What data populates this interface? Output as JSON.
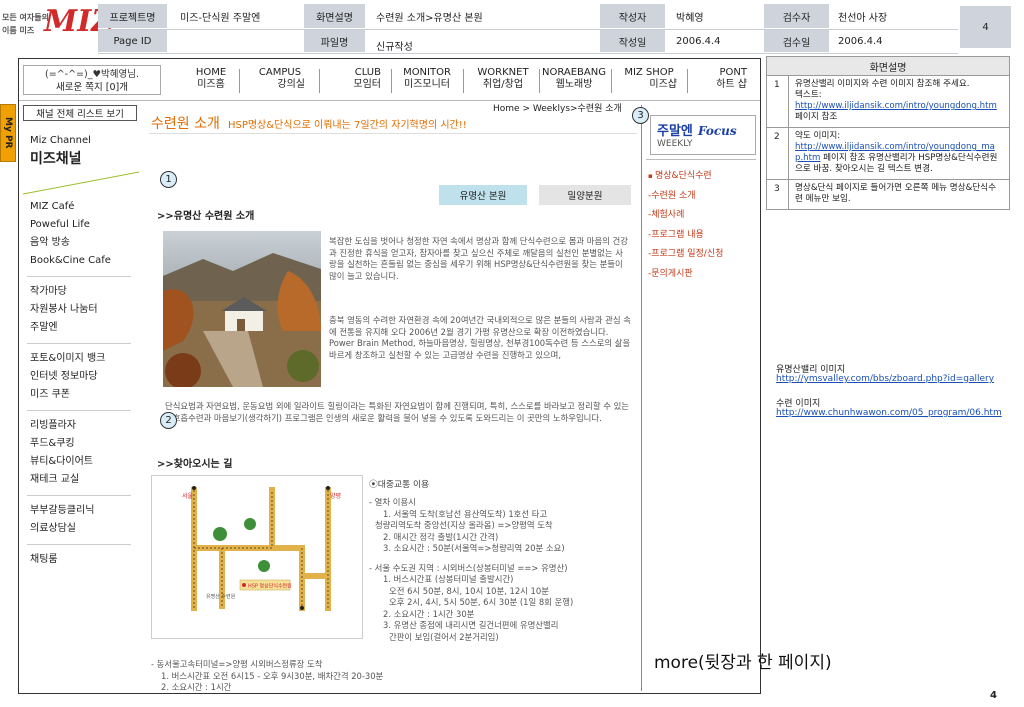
{
  "header": {
    "logo_line1": "모든 여자들의",
    "logo_line2": "이름 미즈",
    "logo_big": "MIZ",
    "project_label": "프로젝트명",
    "project_value": "미즈-단식원 주말엔",
    "page_id_label": "Page ID",
    "screen_label": "화면설명",
    "screen_value": "수련원 소개>유명산 본원",
    "file_label": "파일명",
    "file_value": "신규작성",
    "author_label": "작성자",
    "author_value": "박혜영",
    "date_label": "작성일",
    "date_value": "2006.4.4",
    "reviewer_label": "검수자",
    "reviewer_value": "천선아 사장",
    "review_date_label": "검수일",
    "review_date_value": "2006.4.4",
    "page_number": "4"
  },
  "login": {
    "line1": "(=^-^=)_♥박혜영님.",
    "line2": "새로운 쪽지 [0]개"
  },
  "nav": [
    {
      "en": "HOME",
      "ko": "미즈홈"
    },
    {
      "en": "CAMPUS",
      "ko": "강의실"
    },
    {
      "en": "CLUB",
      "ko": "모임터"
    },
    {
      "en": "MONITOR",
      "ko": "미즈모니터"
    },
    {
      "en": "WORKNET",
      "ko": "취업/창업"
    },
    {
      "en": "NORAEBANG",
      "ko": "웹노래방"
    },
    {
      "en": "MIZ SHOP",
      "ko": "미즈샵"
    },
    {
      "en": "PONT",
      "ko": "하트 샵"
    }
  ],
  "mypr": "My PR",
  "sidebar": {
    "channel_list_button": "채널 전체 리스트 보기",
    "channel_en": "Miz Channel",
    "channel_ko": "미즈채널",
    "groups": [
      [
        "MIZ Café",
        "Poweful Life",
        "음악 방송",
        "Book&Cine Cafe"
      ],
      [
        "작가마당",
        "자원봉사 나눔터",
        "주말엔"
      ],
      [
        "포토&이미지 뱅크",
        "인터넷 정보마당",
        "미즈 쿠폰"
      ],
      [
        "리빙플라자",
        "푸드&쿠킹",
        "뷰티&다이어트",
        "재테크 교실"
      ],
      [
        "부부갈등클리닉",
        "의료상담실"
      ],
      [
        "채팅룸"
      ]
    ]
  },
  "main": {
    "breadcrumb": "Home > Weeklys>수련원 소개",
    "title": "수련원 소개",
    "title_sub": "HSP명상&단식으로 이뤄내는 7일간의 자기혁명의 시간!!",
    "tab_active": "유명산 본원",
    "tab_inactive": "밀양분원",
    "section1_title": ">>유명산 수련원 소개",
    "intro_p1": "복잡한 도심을 벗어나 청정한 자연 속에서 명상과 함께 단식수련으로 몸과 마음의 건강과 진정한 휴식을 얻고자, 참자아를 찾고 싶으신 주체로 깨달음의 실천인 분별없는 사랑을 실천하는 흔들림 없는 중심을 세우기 위해 HSP명상&단식수련원을 찾는 분들이 많이 늘고 있습니다.",
    "intro_p2": "충북 영동의 수려한 자연환경 속에 20여년간 국내외적으로 많은 분들의 사랑과 관심 속에 전통을 유지해 오다 2006년 2월 경기 가평 유명산으로 확장 이전하였습니다. Power Brain Method, 하늘마음명상, 힐링명상, 천부경100독수련 등 스스로의 삶을 바르게 창조하고 실천할 수 있는 고급명상 수련을 진행하고 있으며,",
    "intro_p3": "단식요법과 자연요법, 운동요법 외에 일라이트 힐링이라는 특화된 자연요법이 함께 진행되며, 특히, 스스로를 바라보고 정리할 수 있는 뇌호흡수련과 마음보기(생각하기) 프로그램은 인생의 새로운 활력을 불어 넣을 수 있도록 도와드리는 이 곳만의 노하우입니다.",
    "section2_title": ">>찾아오시는 길",
    "transport_title": "⦿대중교통 이용",
    "transport_lines": [
      "- 열차 이용시",
      "1. 서울역 도착(호남선 용산역도착) 1호선 타고",
      "청량리역도착 중앙선(지상 올라옴) =>양평역 도착",
      "2. 매시간 정각 출발(1시간 간격)",
      "3. 소요시간 : 50분(서울역=>청량리역 20분 소요)",
      "- 서울 수도권 지역 : 시외버스(상봉터미널 ==> 유명산)",
      "1. 버스시간표 (상봉터미널 출발시간)",
      "오전 6시 50분, 8시, 10시 10분, 12시 10분",
      "오후 2시, 4시, 5시 50분, 6시 30분 (1일 8회 운행)",
      "2. 소요시간 : 1시간 30분",
      "3. 유명산 종점에 내리시면 길건너편에 유명산밸리",
      "간판이 보임(걸어서 2분거리임)"
    ],
    "bottom_lines": [
      "- 동서울고속터미널=>양평 시외버스정류장 도착",
      "1. 버스시간표 오전 6시15 - 오후 9시30분, 배차간격 20-30분",
      "2. 소요시간 : 1시간"
    ],
    "map_labels": {
      "seoul": "서울",
      "yangpyeong": "양평",
      "center": "HSP 명상단식수련원",
      "station": "유명산 수련원"
    }
  },
  "focus": {
    "title_ko": "주말엔",
    "title_en": "Focus",
    "weekly": "WEEKLY",
    "items": [
      "명상&단식수련",
      "-수련원 소개",
      "-체험사례",
      "-프로그램 내용",
      "-프로그램 일정/신청",
      "-문의게시판"
    ]
  },
  "numbers": [
    "1",
    "2",
    "3"
  ],
  "notes": {
    "title": "화면설명",
    "rows": [
      {
        "n": "1",
        "lines": [
          "유명산밸리 이미지와 수련 이미지 참조해 주세요.",
          "텍스트:"
        ],
        "link": "http://www.iljidansik.com/intro/youngdong.htm",
        "after": "페이지 참조"
      },
      {
        "n": "2",
        "lines": [
          "약도 이미지:"
        ],
        "link": "http://www.iljidansik.com/intro/youngdong_map.htm",
        "after": "페이지 참조 유명산밸리가 HSP명상&단식수련원으로 바꿈. 찾아오시는 길 텍스트 변경."
      },
      {
        "n": "3",
        "lines": [
          "명상&단식 페이지로 들어가면 오른쪽 메뉴 명상&단식수련 메뉴만 보임."
        ],
        "link": "",
        "after": ""
      }
    ],
    "img_label1": "유명산밸리 이미지",
    "img_link1": "http://ymsvalley.com/bbs/zboard.php?id=gallery",
    "img_label2": "수련 이미지",
    "img_link2": "http://www.chunhwawon.com/05_program/06.htm"
  },
  "more": "more(뒷장과 한 페이지)",
  "footer_page": "4",
  "colors": {
    "accent": "#e06d00",
    "brand_red": "#d12a2a",
    "focus_blue": "#1b3fa6",
    "menu_red": "#c23a1a",
    "tab_active": "#bfe1ec"
  }
}
